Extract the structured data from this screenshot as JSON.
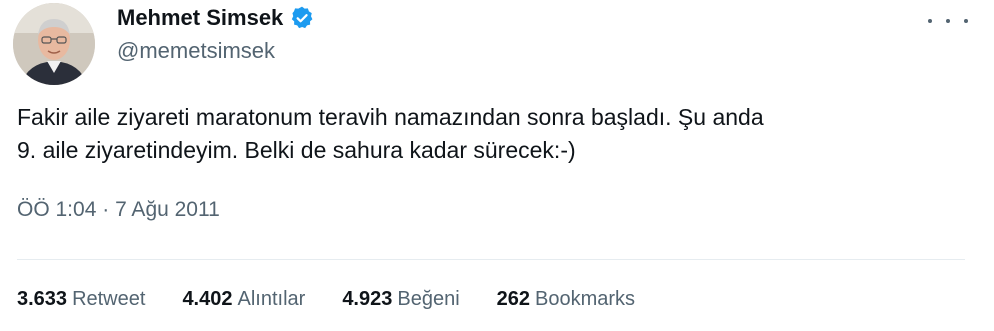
{
  "author": {
    "display_name": "Mehmet Simsek",
    "handle": "@memetsimsek",
    "verified": true
  },
  "tweet": {
    "text": "Fakir aile ziyareti maratonum teravih namazından sonra başladı. Şu anda\n9. aile ziyaretindeyim. Belki de sahura kadar sürecek:-)",
    "time": "ÖÖ 1:04",
    "separator": "·",
    "date": "7 Ağu 2011"
  },
  "stats": [
    {
      "count": "3.633",
      "label": "Retweet"
    },
    {
      "count": "4.402",
      "label": "Alıntılar"
    },
    {
      "count": "4.923",
      "label": "Beğeni"
    },
    {
      "count": "262",
      "label": "Bookmarks"
    }
  ],
  "icons": {
    "more": "more-horizontal-icon",
    "verified": "verified-badge-icon"
  },
  "colors": {
    "verified_blue": "#1d9bf0",
    "secondary_text": "#536471",
    "primary_text": "#0f1419"
  }
}
